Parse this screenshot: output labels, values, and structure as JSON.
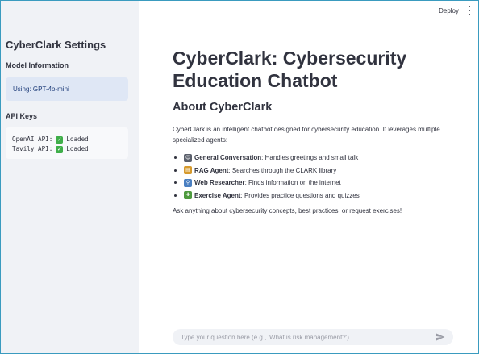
{
  "sidebar": {
    "title": "CyberClark Settings",
    "model_header": "Model Information",
    "model_info": "Using: GPT-4o-mini",
    "api_header": "API Keys",
    "api_lines": [
      {
        "label": "OpenAI API:",
        "status": "Loaded"
      },
      {
        "label": "Tavily API:",
        "status": "Loaded"
      }
    ]
  },
  "header": {
    "deploy_label": "Deploy"
  },
  "main": {
    "title": "CyberClark: Cybersecurity Education Chatbot",
    "about_heading": "About CyberClark",
    "description": "CyberClark is an intelligent chatbot designed for cybersecurity education. It leverages multiple specialized agents:",
    "agents": [
      {
        "icon": "robot-icon",
        "name": "General Conversation",
        "desc": ": Handles greetings and small talk",
        "color": "#5a5f6b"
      },
      {
        "icon": "books-icon",
        "name": "RAG Agent",
        "desc": ": Searches through the CLARK library",
        "color": "#d69a2d"
      },
      {
        "icon": "magnifier-icon",
        "name": "Web Researcher",
        "desc": ": Finds information on the internet",
        "color": "#4a7fc1"
      },
      {
        "icon": "puzzle-icon",
        "name": "Exercise Agent",
        "desc": ": Provides practice questions and quizzes",
        "color": "#4e9a3e"
      }
    ],
    "closing": "Ask anything about cybersecurity concepts, best practices, or request exercises!"
  },
  "chat": {
    "placeholder": "Type your question here (e.g., 'What is risk management?')"
  },
  "colors": {
    "sidebar_bg": "#f0f2f6",
    "info_bg": "#dfe7f5",
    "check_green": "#3fae49"
  }
}
